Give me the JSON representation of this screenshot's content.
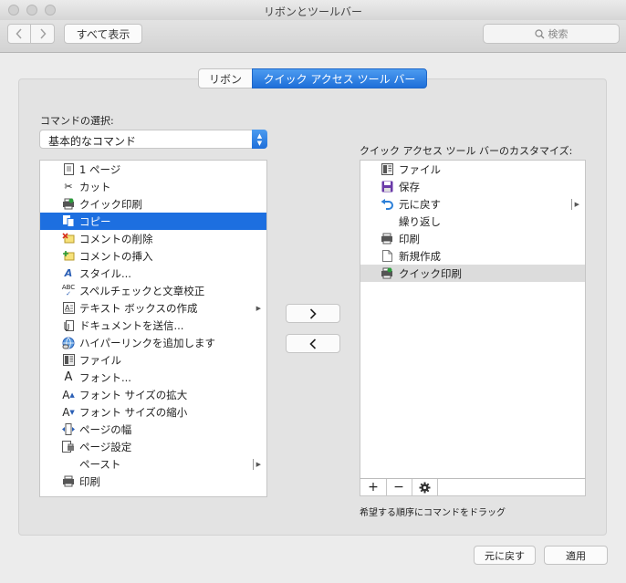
{
  "window": {
    "title": "リボンとツールバー"
  },
  "toolbar": {
    "show_all": "すべて表示",
    "search_placeholder": "検索"
  },
  "tabs": [
    {
      "label": "リボン",
      "selected": false
    },
    {
      "label": "クイック アクセス ツール バー",
      "selected": true
    }
  ],
  "commands": {
    "label": "コマンドの選択:",
    "selected": "基本的なコマンド",
    "items": [
      {
        "label": "1 ページ",
        "icon": "page-icon"
      },
      {
        "label": "カット",
        "icon": "scissors-icon"
      },
      {
        "label": "クイック印刷",
        "icon": "quick-print-icon"
      },
      {
        "label": "コピー",
        "icon": "copy-icon",
        "selected": true
      },
      {
        "label": "コメントの削除",
        "icon": "delete-comment-icon"
      },
      {
        "label": "コメントの挿入",
        "icon": "insert-comment-icon"
      },
      {
        "label": "スタイル...",
        "icon": "style-icon"
      },
      {
        "label": "スペルチェックと文章校正",
        "icon": "spellcheck-icon"
      },
      {
        "label": "テキスト ボックスの作成",
        "icon": "textbox-icon",
        "submenu": true
      },
      {
        "label": "ドキュメントを送信...",
        "icon": "attachment-icon"
      },
      {
        "label": "ハイパーリンクを追加します",
        "icon": "hyperlink-icon"
      },
      {
        "label": "ファイル",
        "icon": "file-menu-icon"
      },
      {
        "label": "フォント...",
        "icon": "font-icon"
      },
      {
        "label": "フォント サイズの拡大",
        "icon": "font-grow-icon"
      },
      {
        "label": "フォント サイズの縮小",
        "icon": "font-shrink-icon"
      },
      {
        "label": "ページの幅",
        "icon": "page-width-icon"
      },
      {
        "label": "ページ設定",
        "icon": "page-setup-icon"
      },
      {
        "label": "ペースト",
        "icon": "",
        "submenu_bar": true
      },
      {
        "label": "印刷",
        "icon": "print-icon"
      }
    ]
  },
  "move": {
    "add": "›",
    "remove": "‹"
  },
  "qat": {
    "label": "クイック アクセス ツール バーのカスタマイズ:",
    "items": [
      {
        "label": "ファイル",
        "icon": "file-menu-icon"
      },
      {
        "label": "保存",
        "icon": "save-icon"
      },
      {
        "label": "元に戻す",
        "icon": "undo-icon",
        "submenu_bar": true
      },
      {
        "label": "繰り返し",
        "icon": ""
      },
      {
        "label": "印刷",
        "icon": "print-icon"
      },
      {
        "label": "新規作成",
        "icon": "new-document-icon"
      },
      {
        "label": "クイック印刷",
        "icon": "quick-print-icon",
        "highlighted": true
      }
    ],
    "add_btn": "+",
    "remove_btn": "−",
    "gear": "⚙",
    "hint": "希望する順序にコマンドをドラッグ"
  },
  "buttons": {
    "revert": "元に戻す",
    "apply": "適用"
  }
}
